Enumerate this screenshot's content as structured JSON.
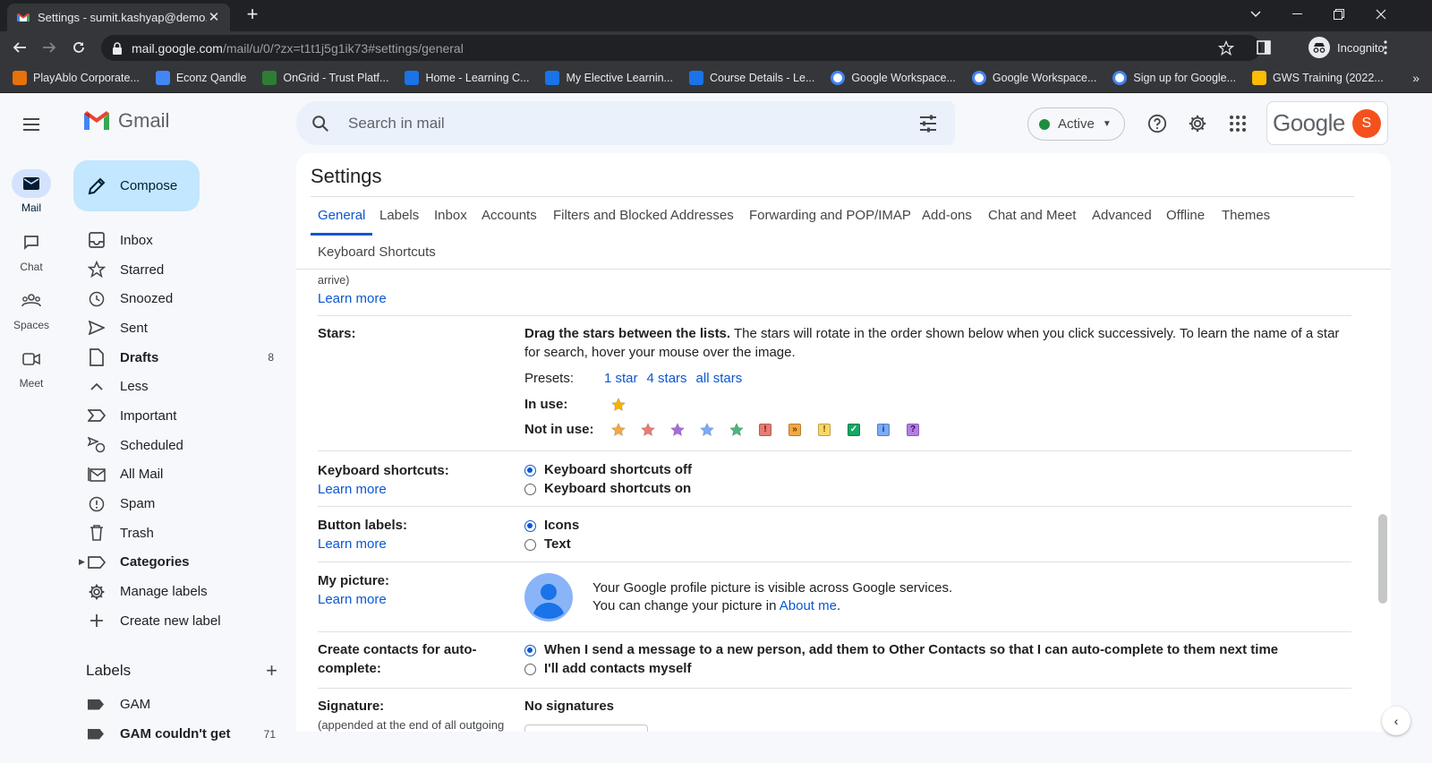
{
  "browser": {
    "tab_title": "Settings - sumit.kashyap@demo...",
    "url_host": "mail.google.com",
    "url_path": "/mail/u/0/?zx=t1t1j5g1ik73#settings/general",
    "incognito_label": "Incognito",
    "bookmarks": [
      {
        "label": "PlayAblo Corporate...",
        "color": "#e8710a"
      },
      {
        "label": "Econz Qandle",
        "color": "#4285f4"
      },
      {
        "label": "OnGrid - Trust Platf...",
        "color": "#2e7d32"
      },
      {
        "label": "Home - Learning C...",
        "color": "#1a73e8"
      },
      {
        "label": "My Elective Learnin...",
        "color": "#1a73e8"
      },
      {
        "label": "Course Details - Le...",
        "color": "#1a73e8"
      },
      {
        "label": "Google Workspace...",
        "color": "#ffffff"
      },
      {
        "label": "Google Workspace...",
        "color": "#ffffff"
      },
      {
        "label": "Sign up for Google...",
        "color": "#ffffff"
      },
      {
        "label": "GWS Training (2022...",
        "color": "#fbbc04"
      }
    ],
    "bookmarks_more": "»"
  },
  "rail": {
    "items": [
      {
        "label": "Mail",
        "icon": "mail-icon"
      },
      {
        "label": "Chat",
        "icon": "chat-icon"
      },
      {
        "label": "Spaces",
        "icon": "spaces-icon"
      },
      {
        "label": "Meet",
        "icon": "meet-icon"
      }
    ]
  },
  "app": {
    "name": "Gmail",
    "compose": "Compose"
  },
  "nav": {
    "items": [
      {
        "label": "Inbox",
        "icon": "inbox-icon",
        "count": "",
        "bold": false
      },
      {
        "label": "Starred",
        "icon": "star-icon",
        "count": "",
        "bold": false
      },
      {
        "label": "Snoozed",
        "icon": "clock-icon",
        "count": "",
        "bold": false
      },
      {
        "label": "Sent",
        "icon": "send-icon",
        "count": "",
        "bold": false
      },
      {
        "label": "Drafts",
        "icon": "draft-icon",
        "count": "8",
        "bold": true
      },
      {
        "label": "Less",
        "icon": "chevron-up-icon",
        "count": "",
        "bold": false
      },
      {
        "label": "Important",
        "icon": "important-icon",
        "count": "",
        "bold": false
      },
      {
        "label": "Scheduled",
        "icon": "scheduled-icon",
        "count": "",
        "bold": false
      },
      {
        "label": "All Mail",
        "icon": "all-mail-icon",
        "count": "",
        "bold": false
      },
      {
        "label": "Spam",
        "icon": "spam-icon",
        "count": "",
        "bold": false
      },
      {
        "label": "Trash",
        "icon": "trash-icon",
        "count": "",
        "bold": false
      },
      {
        "label": "Categories",
        "icon": "label-icon",
        "count": "",
        "bold": true
      },
      {
        "label": "Manage labels",
        "icon": "gear-icon",
        "count": "",
        "bold": false
      },
      {
        "label": "Create new label",
        "icon": "plus-icon",
        "count": "",
        "bold": false
      }
    ]
  },
  "labels": {
    "title": "Labels",
    "items": [
      {
        "label": "GAM",
        "count": ""
      },
      {
        "label": "GAM couldn't get",
        "count": "71"
      }
    ]
  },
  "header": {
    "search_placeholder": "Search in mail",
    "status": "Active",
    "brand": "Google",
    "avatar_letter": "S"
  },
  "settings": {
    "title": "Settings",
    "tabs": [
      "General",
      "Labels",
      "Inbox",
      "Accounts",
      "Filters and Blocked Addresses",
      "Forwarding and POP/IMAP",
      "Add-ons",
      "Chat and Meet",
      "Advanced",
      "Offline",
      "Themes",
      "Keyboard Shortcuts"
    ],
    "active_tab": "General",
    "prev_row": {
      "text": "arrive)",
      "link": "Learn more"
    },
    "stars": {
      "label": "Stars:",
      "desc_bold": "Drag the stars between the lists.",
      "desc": " The stars will rotate in the order shown below when you click successively. To learn the name of a star for search, hover your mouse over the image.",
      "presets_label": "Presets:",
      "presets": [
        "1 star",
        "4 stars",
        "all stars"
      ],
      "in_use_label": "In use:",
      "not_in_use_label": "Not in use:",
      "in_use_colors": [
        "#f4b400"
      ],
      "not_in_use_stars": [
        "#f4a742",
        "#e67c73",
        "#a56dd6",
        "#7baaf7",
        "#4fb47a"
      ],
      "not_in_use_marks": [
        {
          "glyph": "!",
          "bg": "#e67c73",
          "fg": "#8b0000"
        },
        {
          "glyph": "»",
          "bg": "#f4a742",
          "fg": "#6a3b00"
        },
        {
          "glyph": "!",
          "bg": "#fdd663",
          "fg": "#5f4b00"
        },
        {
          "glyph": "✓",
          "bg": "#16a765",
          "fg": "#ffffff"
        },
        {
          "glyph": "i",
          "bg": "#7baaf7",
          "fg": "#0b3a8a"
        },
        {
          "glyph": "?",
          "bg": "#b47fe3",
          "fg": "#3d0a6b"
        }
      ]
    },
    "keyboard": {
      "label": "Keyboard shortcuts:",
      "link": "Learn more",
      "options": [
        "Keyboard shortcuts off",
        "Keyboard shortcuts on"
      ],
      "selected": 0
    },
    "button_labels": {
      "label": "Button labels:",
      "link": "Learn more",
      "options": [
        "Icons",
        "Text"
      ],
      "selected": 0
    },
    "picture": {
      "label": "My picture:",
      "link": "Learn more",
      "line1": "Your Google profile picture is visible across Google services.",
      "line2_pre": "You can change your picture in ",
      "line2_link": "About me",
      "line2_post": "."
    },
    "contacts": {
      "label": "Create contacts for auto-complete:",
      "options": [
        "When I send a message to a new person, add them to Other Contacts so that I can auto-complete to them next time",
        "I'll add contacts myself"
      ],
      "selected": 0
    },
    "signature": {
      "label": "Signature:",
      "sub": "(appended at the end of all outgoing",
      "value": "No signatures"
    }
  }
}
